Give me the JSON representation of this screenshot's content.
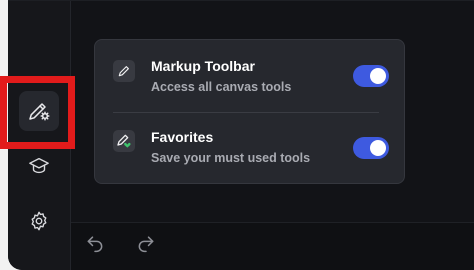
{
  "popover": {
    "markup_toolbar": {
      "title": "Markup Toolbar",
      "subtitle": "Access all canvas tools",
      "icon": "pencil-square-icon",
      "enabled": true
    },
    "favorites": {
      "title": "Favorites",
      "subtitle": "Save your must used tools",
      "icon": "pencil-heart-icon",
      "enabled": true
    }
  },
  "sidebar": {
    "items": [
      {
        "icon": "pencil-gear-icon",
        "active": true
      },
      {
        "icon": "graduation-cap-icon",
        "active": false
      },
      {
        "icon": "gear-icon",
        "active": false
      }
    ]
  },
  "bottom_bar": {
    "undo_icon": "undo-icon",
    "redo_icon": "redo-icon"
  },
  "colors": {
    "accent": "#3e5ae0",
    "highlight": "#e21b1b",
    "heart": "#3ec46d"
  }
}
